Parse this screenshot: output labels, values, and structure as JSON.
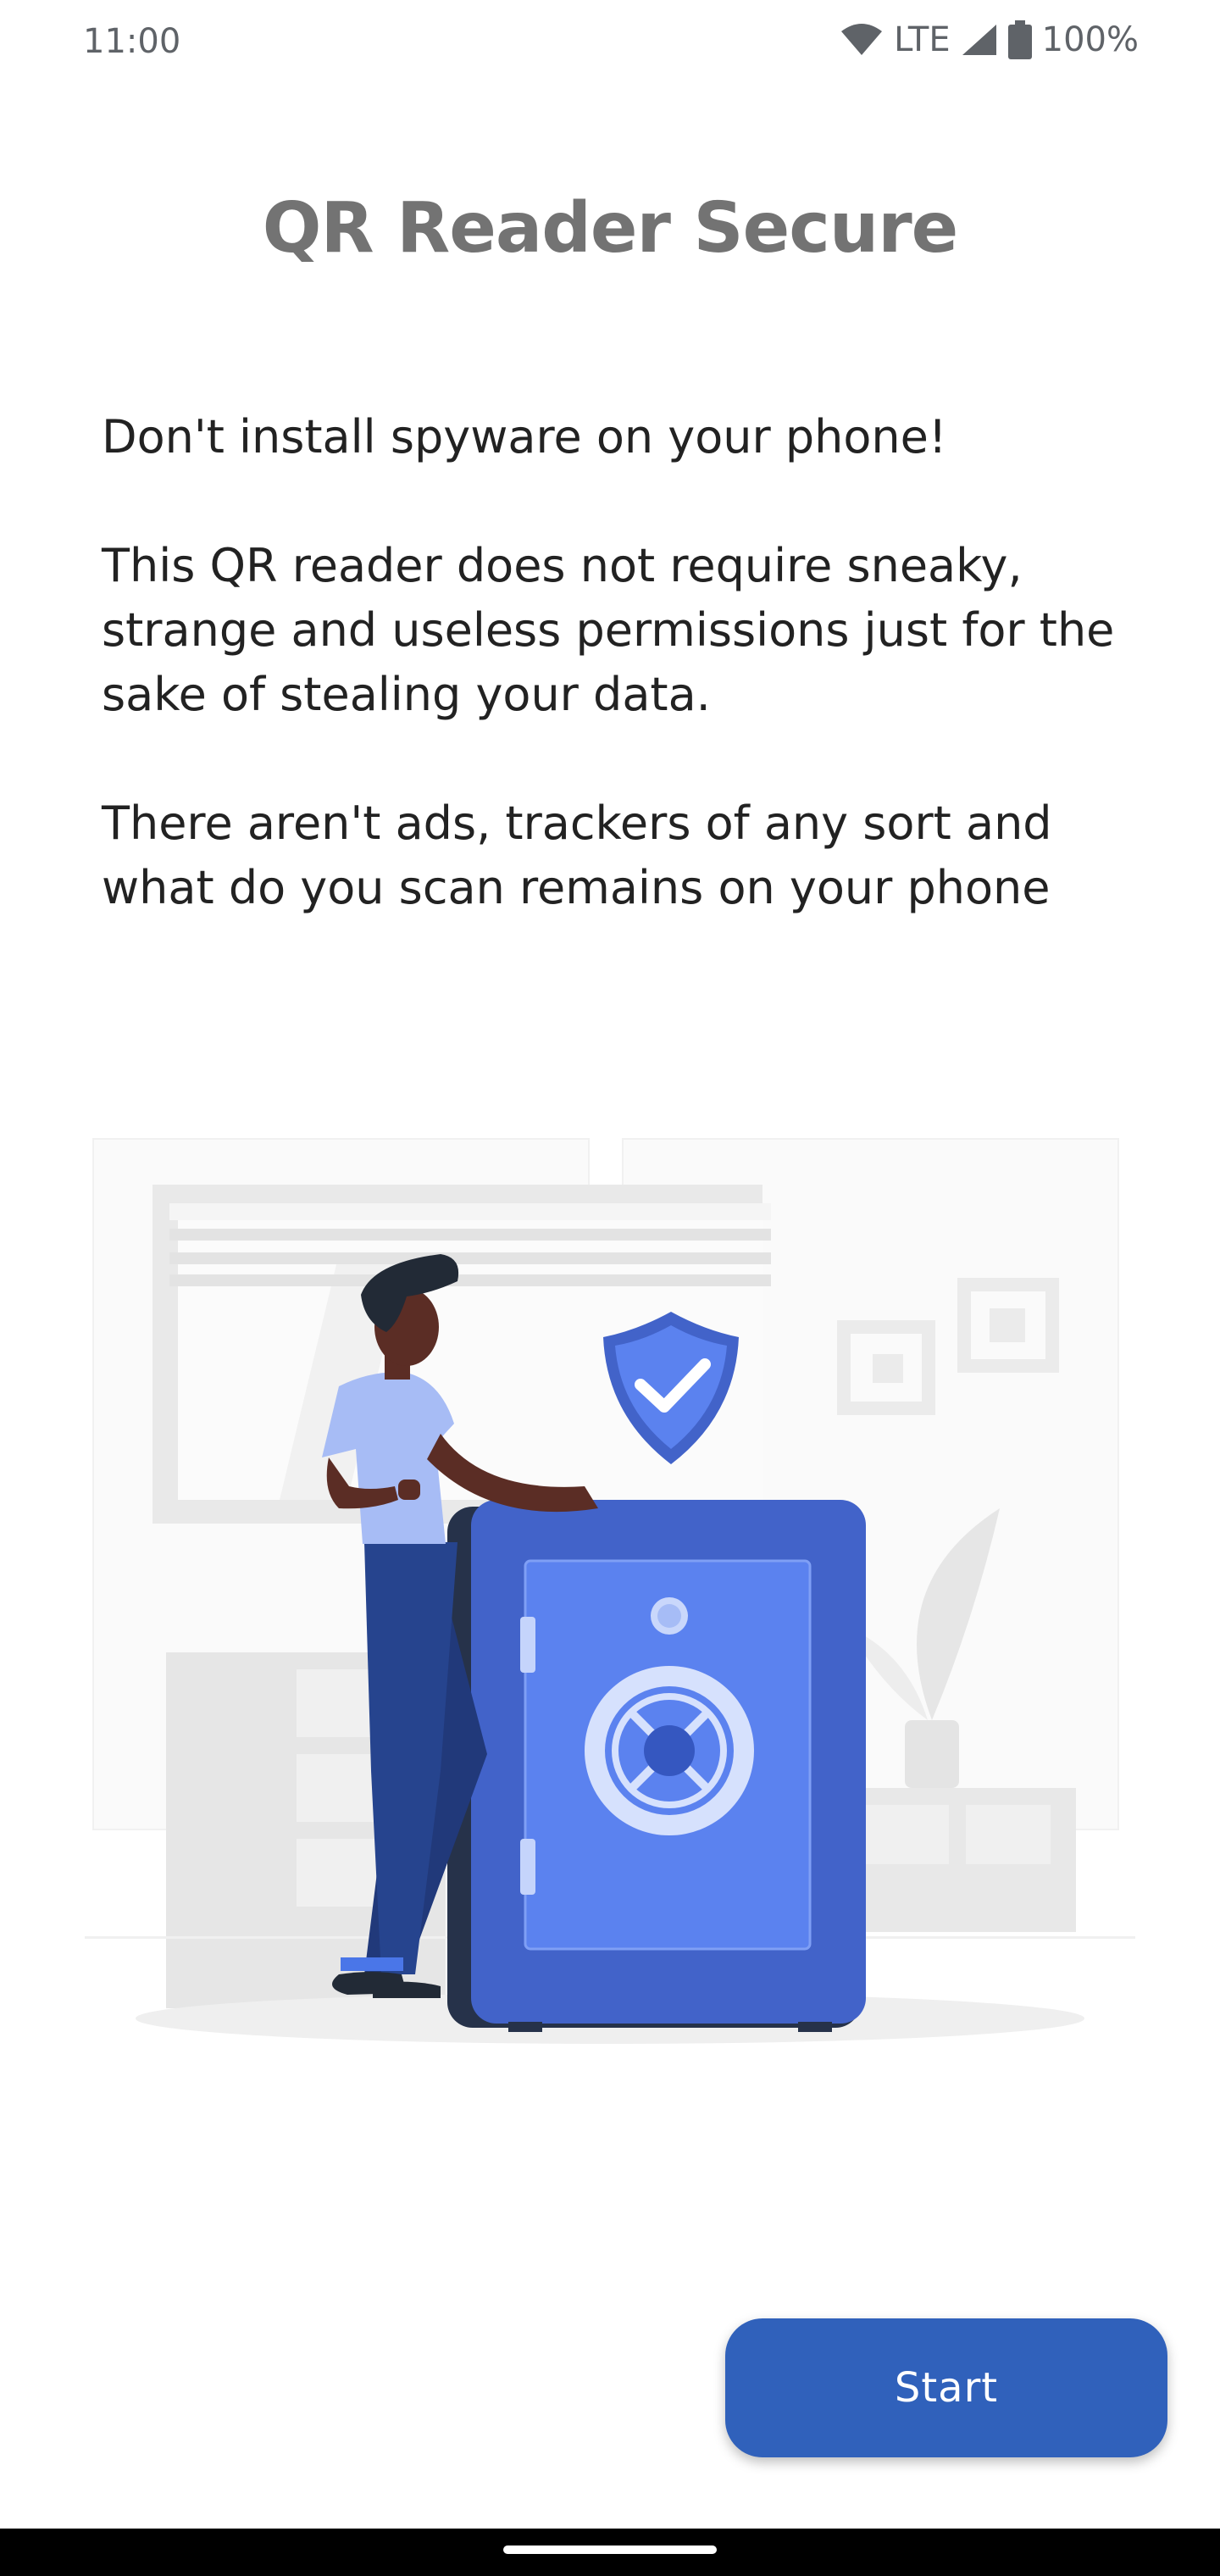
{
  "status_bar": {
    "time": "11:00",
    "network": "LTE",
    "battery": "100%"
  },
  "screen": {
    "title": "QR Reader Secure",
    "paragraphs": [
      "Don't install spyware on your phone!",
      "This QR reader does not require sneaky, strange and useless permissions just for the sake of stealing your data.",
      "There aren't ads, trackers of any sort and what do you scan remains on your phone"
    ],
    "illustration_icon": "person-leaning-on-safe-with-shield-illustration"
  },
  "actions": {
    "start_label": "Start"
  },
  "colors": {
    "accent": "#3061bb",
    "safe_body": "#4263c9",
    "safe_door": "#5b82ef",
    "title": "#737373"
  }
}
